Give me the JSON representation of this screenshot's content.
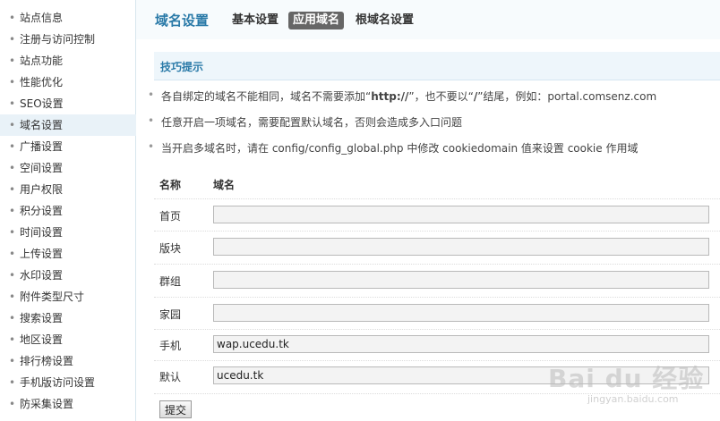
{
  "sidebar": {
    "items": [
      {
        "label": "站点信息"
      },
      {
        "label": "注册与访问控制"
      },
      {
        "label": "站点功能"
      },
      {
        "label": "性能优化"
      },
      {
        "label": "SEO设置"
      },
      {
        "label": "域名设置"
      },
      {
        "label": "广播设置"
      },
      {
        "label": "空间设置"
      },
      {
        "label": "用户权限"
      },
      {
        "label": "积分设置"
      },
      {
        "label": "时间设置"
      },
      {
        "label": "上传设置"
      },
      {
        "label": "水印设置"
      },
      {
        "label": "附件类型尺寸"
      },
      {
        "label": "搜索设置"
      },
      {
        "label": "地区设置"
      },
      {
        "label": "排行榜设置"
      },
      {
        "label": "手机版访问设置"
      },
      {
        "label": "防采集设置"
      }
    ],
    "active_index": 5
  },
  "header": {
    "title": "域名设置",
    "tabs": [
      {
        "label": "基本设置"
      },
      {
        "label": "应用域名"
      },
      {
        "label": "根域名设置"
      }
    ],
    "active_tab": 1
  },
  "tips": {
    "title": "技巧提示",
    "items": [
      {
        "pre": "各自绑定的域名不能相同，域名不需要添加“",
        "bold1": "http://",
        "mid": "”，也不要以“",
        "bold2": "/",
        "post": "”结尾，例如：portal.comsenz.com"
      },
      {
        "text": "任意开启一项域名，需要配置默认域名，否则会造成多入口问题"
      },
      {
        "text": "当开启多域名时，请在 config/config_global.php 中修改 cookiedomain 值来设置 cookie 作用域"
      }
    ]
  },
  "table": {
    "col_name": "名称",
    "col_domain": "域名",
    "rows": [
      {
        "label": "首页",
        "value": ""
      },
      {
        "label": "版块",
        "value": ""
      },
      {
        "label": "群组",
        "value": ""
      },
      {
        "label": "家园",
        "value": ""
      },
      {
        "label": "手机",
        "value": "wap.ucedu.tk"
      },
      {
        "label": "默认",
        "value": "ucedu.tk"
      }
    ]
  },
  "submit_label": "提交",
  "watermark": {
    "logo": "Bai du 经验",
    "sub": "jingyan.baidu.com"
  }
}
